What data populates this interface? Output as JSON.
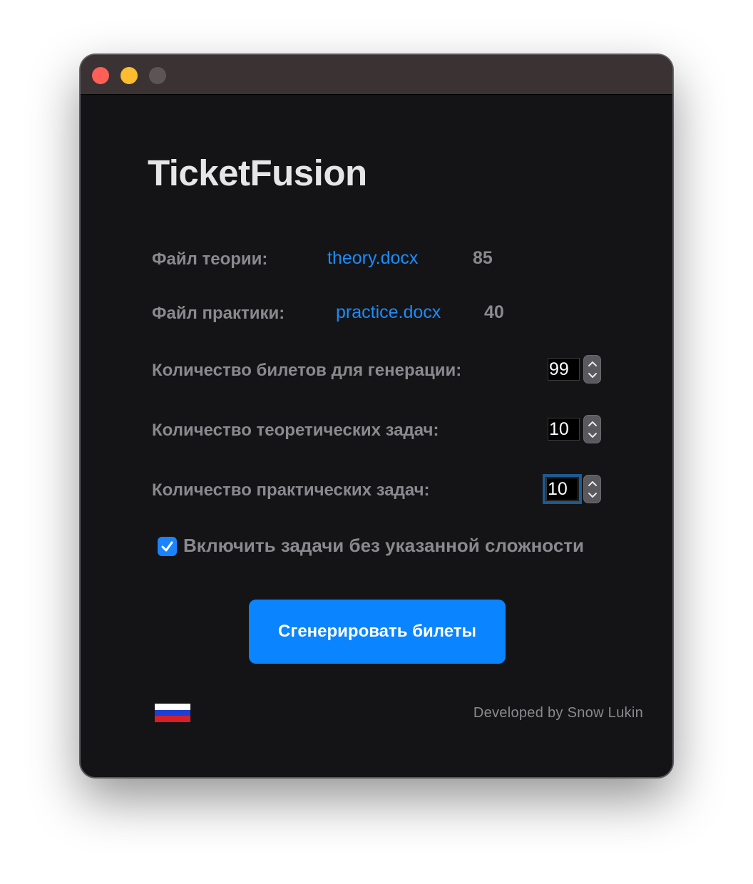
{
  "app": {
    "title": "TicketFusion"
  },
  "files": {
    "theory": {
      "label": "Файл теории:",
      "file": "theory.docx",
      "count": "85"
    },
    "practice": {
      "label": "Файл практики:",
      "file": "practice.docx",
      "count": "40"
    }
  },
  "settings": {
    "tickets": {
      "label": "Количество билетов для генерации:",
      "value": "99"
    },
    "theory_tasks": {
      "label": "Количество теоретических задач:",
      "value": "10"
    },
    "practice_tasks": {
      "label": "Количество практических задач:",
      "value": "10"
    }
  },
  "include_unrated": {
    "label": "Включить задачи без указанной сложности",
    "checked": true
  },
  "generate_button": {
    "label": "Сгенерировать билеты"
  },
  "footer": {
    "language_flag": "russia-flag",
    "developed": "Developed by Snow Lukin"
  },
  "colors": {
    "window_bg": "#141417",
    "titlebar_bg": "#3b3234",
    "accent": "#0a84ff",
    "link": "#1b8cfb",
    "label": "#8a8a8e",
    "title": "#e6e6e7"
  }
}
